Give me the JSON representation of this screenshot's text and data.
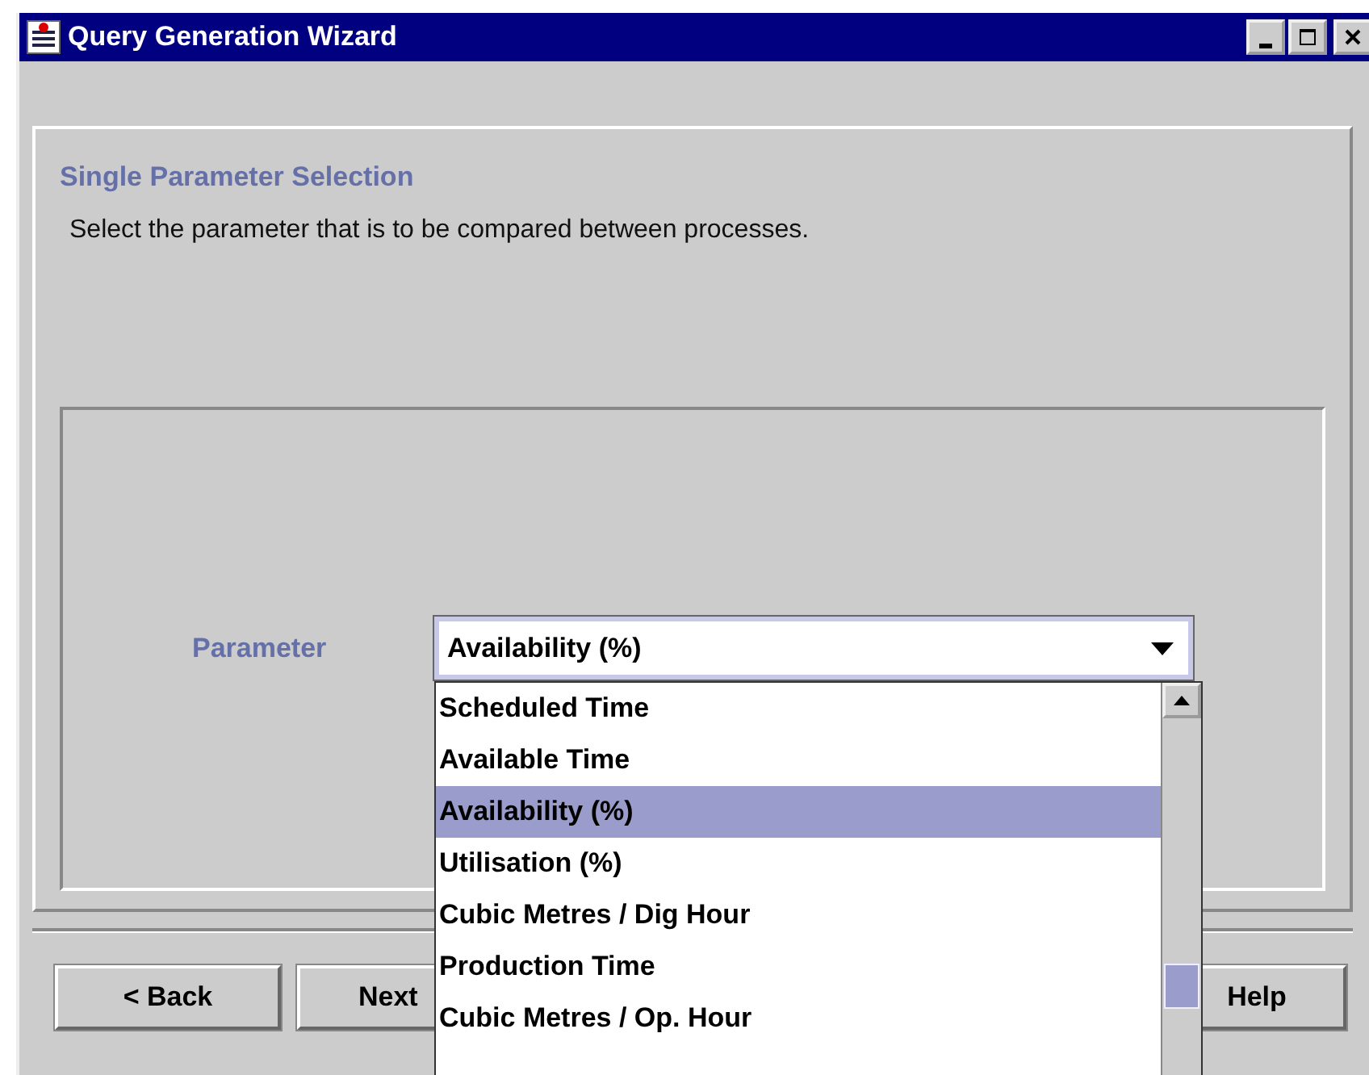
{
  "window": {
    "title": "Query Generation Wizard"
  },
  "step": {
    "title": "Single Parameter Selection",
    "description": "Select the parameter that is to be compared between processes."
  },
  "parameter": {
    "label": "Parameter",
    "value": "Availability (%)",
    "expanded": true,
    "options": [
      {
        "label": "Scheduled Time",
        "selected": false
      },
      {
        "label": "Available Time",
        "selected": false
      },
      {
        "label": "Availability (%)",
        "selected": true
      },
      {
        "label": "Utilisation (%)",
        "selected": false
      },
      {
        "label": "Cubic Metres / Dig Hour",
        "selected": false
      },
      {
        "label": "Production Time",
        "selected": false
      },
      {
        "label": "Cubic Metres / Op. Hour",
        "selected": false
      }
    ]
  },
  "buttons": [
    {
      "label": "< Back"
    },
    {
      "label": "Next"
    },
    {
      "label": "Help"
    }
  ]
}
